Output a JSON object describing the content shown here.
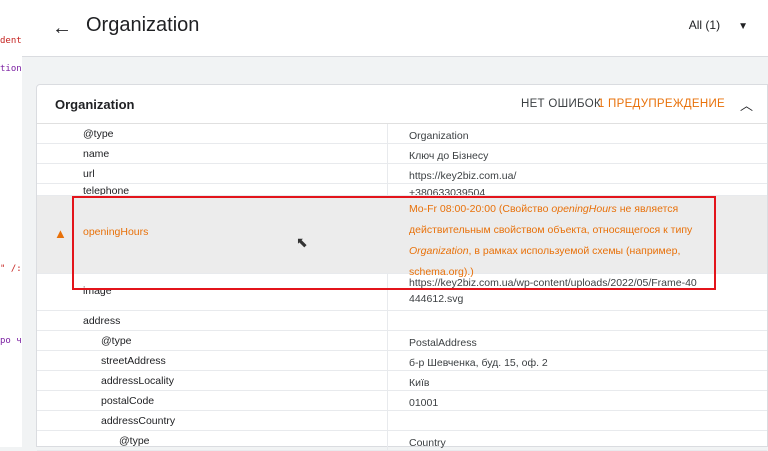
{
  "code_strip": {
    "line1": "dent",
    "line2": "tion",
    "line3": "\" /:",
    "line4": "ро ч"
  },
  "header": {
    "title": "Organization",
    "filter": "All (1)"
  },
  "card": {
    "title": "Organization",
    "no_errors": "НЕТ ОШИБОК",
    "warnings": "1 ПРЕДУПРЕЖДЕНИЕ"
  },
  "rows": [
    {
      "key": "@type",
      "value": "Organization"
    },
    {
      "key": "name",
      "value": "Ключ до Бізнесу"
    },
    {
      "key": "url",
      "value": "https://key2biz.com.ua/"
    },
    {
      "key": "telephone",
      "value": "+380633039504"
    },
    {
      "key": "openingHours",
      "value_a": "Mo-Fr 08:00-20:00 (Свойство ",
      "value_b": "openingHours",
      "value_c": " не является действительным свойством объекта, относящегося к типу ",
      "value_d": "Organization",
      "value_e": ", в рамках используемой схемы (например, schema.org).)"
    },
    {
      "key": "image",
      "value": "https://key2biz.com.ua/wp-content/uploads/2022/05/Frame-40444612.svg"
    },
    {
      "key": "address",
      "value": ""
    },
    {
      "key": "@type",
      "value": "PostalAddress"
    },
    {
      "key": "streetAddress",
      "value": "б-р Шевченка, буд. 15, оф. 2"
    },
    {
      "key": "addressLocality",
      "value": "Київ"
    },
    {
      "key": "postalCode",
      "value": "01001"
    },
    {
      "key": "addressCountry",
      "value": ""
    },
    {
      "key": "@type",
      "value": "Country"
    }
  ],
  "colors": {
    "warning": "#e8710a",
    "highlight": "#e3141b"
  }
}
